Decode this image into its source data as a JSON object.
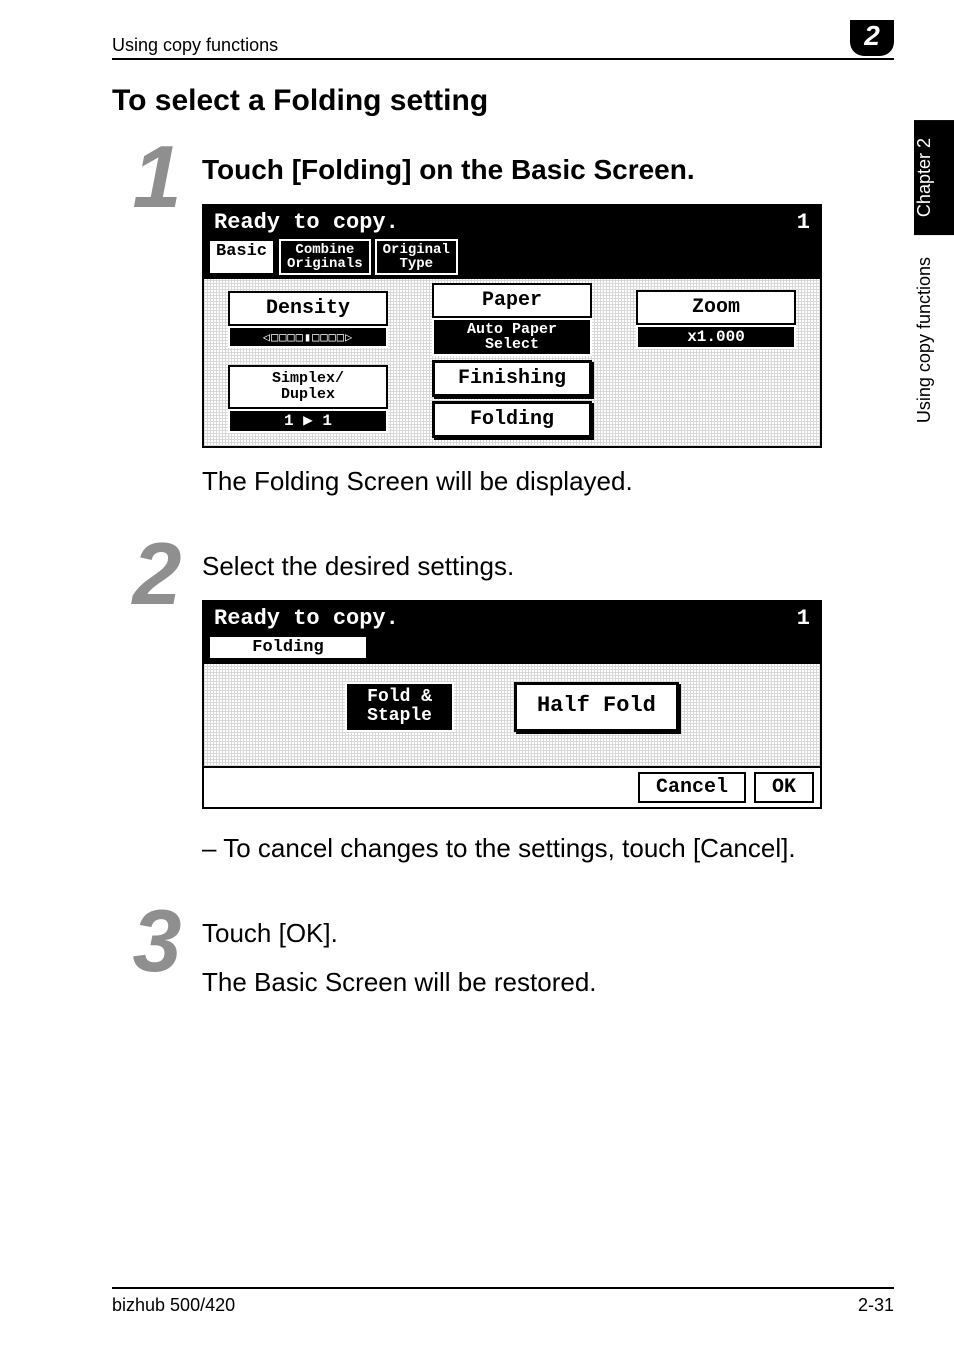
{
  "header": {
    "running": "Using copy functions",
    "chapter_number": "2"
  },
  "side_tab": {
    "black": "Chapter 2",
    "white": "Using copy functions"
  },
  "section_title": "To select a Folding setting",
  "steps": {
    "s1": {
      "num": "1",
      "head": "Touch [Folding] on the Basic Screen.",
      "after_para": "The Folding Screen will be displayed."
    },
    "s2": {
      "num": "2",
      "head": "Select the desired settings.",
      "bullet": "To cancel changes to the settings, touch [Cancel]."
    },
    "s3": {
      "num": "3",
      "head": "Touch [OK].",
      "after_para": "The Basic Screen will be restored."
    }
  },
  "lcd1": {
    "status": "Ready to copy.",
    "count": "1",
    "tabs": {
      "basic": "Basic",
      "combine": "Combine\nOriginals",
      "original": "Original\nType"
    },
    "density_label": "Density",
    "density_bar": "◁□□□□▮□□□□▷",
    "paper_label": "Paper",
    "paper_value": "Auto Paper\nSelect",
    "zoom_label": "Zoom",
    "zoom_value": "x1.000",
    "simplex_label": "Simplex/\nDuplex",
    "simplex_value": "1 ▶ 1",
    "finishing": "Finishing",
    "folding": "Folding"
  },
  "lcd2": {
    "status": "Ready to copy.",
    "count": "1",
    "tab": "Folding",
    "opt_fold_staple": "Fold &\nStaple",
    "opt_half_fold": "Half Fold",
    "cancel": "Cancel",
    "ok": "OK"
  },
  "footer": {
    "left": "bizhub 500/420",
    "right": "2-31"
  }
}
